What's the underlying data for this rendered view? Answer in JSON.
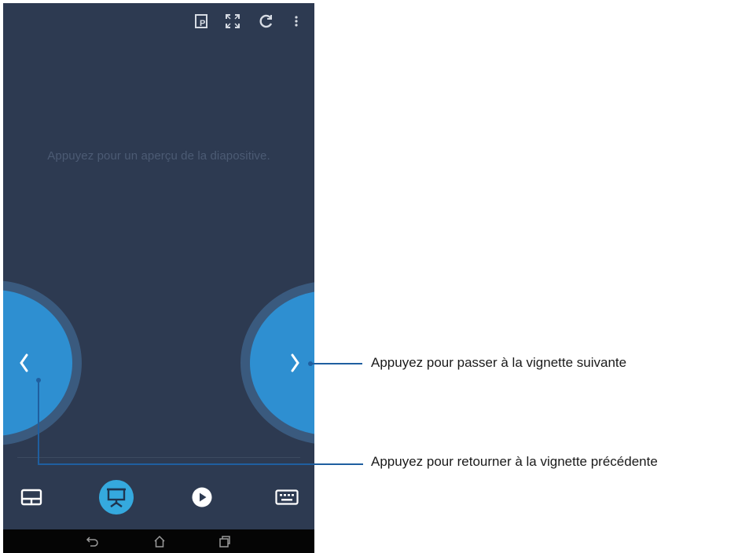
{
  "screen": {
    "hint_text": "Appuyez pour un aperçu de la diapositive.",
    "topbar_icons": [
      "present-mode-icon",
      "fullscreen-icon",
      "refresh-icon",
      "more-options-icon"
    ],
    "nav": {
      "prev_glyph": "‹",
      "next_glyph": "›"
    },
    "bottom_tabs": [
      "touchpad-icon",
      "presentation-icon",
      "play-icon",
      "keyboard-icon"
    ],
    "active_tab": "presentation-icon",
    "system_nav": [
      "back-icon",
      "home-icon",
      "recents-icon"
    ]
  },
  "callouts": {
    "next_label": "Appuyez pour passer à la vignette suivante",
    "prev_label": "Appuyez pour retourner à la vignette précédente"
  },
  "colors": {
    "background": "#2d3a51",
    "nav_circle": "#2e8fd1",
    "active_tab": "#35a9de",
    "callout_line": "#1f5fa0"
  }
}
